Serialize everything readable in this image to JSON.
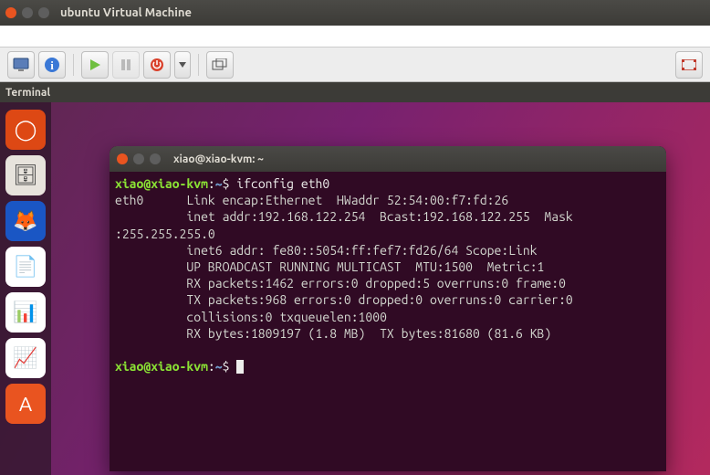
{
  "vm": {
    "title": "ubuntu Virtual Machine",
    "tab": "Terminal"
  },
  "toolbar": {
    "icons": [
      "monitor",
      "info",
      "play",
      "pause",
      "power",
      "dropdown",
      "multi",
      "fullscreen"
    ]
  },
  "launcher": {
    "items": [
      {
        "name": "dash",
        "bg": "#dd4814",
        "glyph": "◯"
      },
      {
        "name": "files",
        "bg": "#e7e3dc",
        "glyph": "🗄"
      },
      {
        "name": "firefox",
        "bg": "#1a56c4",
        "glyph": "🦊"
      },
      {
        "name": "writer",
        "bg": "#ffffff",
        "glyph": "📄"
      },
      {
        "name": "calc",
        "bg": "#ffffff",
        "glyph": "📊"
      },
      {
        "name": "impress",
        "bg": "#ffffff",
        "glyph": "📈"
      },
      {
        "name": "software",
        "bg": "#e95420",
        "glyph": "A"
      }
    ]
  },
  "terminal": {
    "title": "xiao@xiao-kvm: ~",
    "prompt_user": "xiao@xiao-kvm",
    "prompt_sep": ":",
    "prompt_path": "~",
    "prompt_end": "$",
    "command": "ifconfig eth0",
    "output": "eth0      Link encap:Ethernet  HWaddr 52:54:00:f7:fd:26\n          inet addr:192.168.122.254  Bcast:192.168.122.255  Mask\n:255.255.255.0\n          inet6 addr: fe80::5054:ff:fef7:fd26/64 Scope:Link\n          UP BROADCAST RUNNING MULTICAST  MTU:1500  Metric:1\n          RX packets:1462 errors:0 dropped:5 overruns:0 frame:0\n          TX packets:968 errors:0 dropped:0 overruns:0 carrier:0\n          collisions:0 txqueuelen:1000\n          RX bytes:1809197 (1.8 MB)  TX bytes:81680 (81.6 KB)\n"
  }
}
